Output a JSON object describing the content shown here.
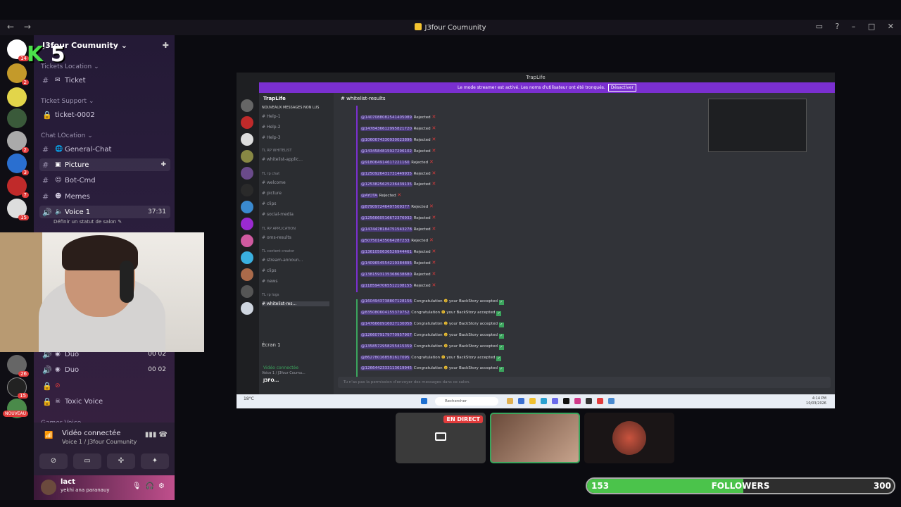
{
  "window": {
    "title": "J3four Coumunity",
    "nav_back": "←",
    "nav_forward": "→"
  },
  "stream_logo": {
    "letter": "K",
    "number": "5"
  },
  "sidebar": {
    "guild_name": "J3four Coumunity",
    "categories": {
      "tickets_location": "Tickets Location",
      "ticket_support": "Ticket Support",
      "chat_location": "Chat LOcation",
      "gamer_voice": "Gamer Voice"
    },
    "channels": {
      "ticket": "Ticket",
      "ticket_0002": "ticket-0002",
      "general_chat": "General-Chat",
      "picture": "Picture",
      "bot_cmd": "Bot-Cmd",
      "memes": "Memes",
      "voice1": "Voice 1",
      "voice1_time": "37:31",
      "status_note": "Définir un statut de salon",
      "duo_a": "Duo",
      "duo_a_count": "00 02",
      "duo_b": "Duo",
      "duo_b_count": "00 02",
      "toxic_voice": "Toxic Voice"
    },
    "server_badges": [
      "14",
      "2",
      "2",
      "2",
      "3",
      "7",
      "15",
      "26",
      "15"
    ],
    "nouveau": "NOUVEAU"
  },
  "voice_panel": {
    "title": "Vidéo connectée",
    "subtitle": "Voice 1 / J3four Coumunity"
  },
  "user": {
    "name": "lact",
    "status": "yekhi ana paranauy"
  },
  "inner_window": {
    "title": "TrapLife",
    "banner_text": "Le mode streamer est activé. Les noms d'utilisateur ont été tronqués.",
    "banner_button": "Désactiver",
    "guild": "TrapLife",
    "new_messages": "NOUVEAUX MESSAGES NON LUS",
    "channels": [
      "Help-1",
      "Help-2",
      "Help-3",
      "TL RP WHITELIST",
      "whitelist-applic...",
      "TL rp chat",
      "welcome",
      "picture",
      "clips",
      "social-media",
      "TL RP APPLICATION",
      "oms-results",
      "TL content creator",
      "stream-announ...",
      "clips",
      "news",
      "TL rp logs",
      "whitelist-res..."
    ],
    "current_channel": "whitelist-results",
    "voice_label": "Écran 1",
    "voice_connected": "Vidéo connectée",
    "voice_sub": "Voice 1 / J3four Coumu...",
    "user": "J3FO...",
    "rejected_word": "Rejected",
    "rejected_mentions": [
      "@1407088082541405089",
      "@1478436612995821720",
      "@1060674330930023896",
      "@1434584815927296102",
      "@918064914617221160",
      "@1250926431731449935",
      "@1253825625236439135",
      "@AYOTA",
      "@879097246497509377",
      "@1256660516672376932",
      "@1474478184751543278",
      "@507501435064287233",
      "@1361050636526944461",
      "@1409654554219384895",
      "@1381593135368638680",
      "@1185947065512108155"
    ],
    "accepted_prefix": "Congratulation",
    "accepted_suffix": "your BackStory accepted",
    "accepted_mentions": [
      "@1604943738807128156",
      "@835080604155379752",
      "@1476660916027130058",
      "@1266079179770957907",
      "@1358572958255415359",
      "@862780168581617095",
      "@1266442333113619945"
    ],
    "input_placeholder": "Tu n'as pas la permission d'envoyer des messages dans ce salon.",
    "taskbar_search": "Rechercher",
    "taskbar_weather": "18°C",
    "clock_time": "4:14 PM",
    "clock_date": "10/03/2026"
  },
  "tiles": {
    "live_label": "EN DIRECT"
  },
  "followers": {
    "current": "153",
    "label": "FOLLOWERS",
    "goal": "300",
    "progress_fraction": 0.51
  },
  "colors": {
    "accent_purple": "#7a2fd0",
    "reject_red": "#e23c3c",
    "accept_green": "#3ba55d",
    "follower_green": "#4bc34b"
  }
}
